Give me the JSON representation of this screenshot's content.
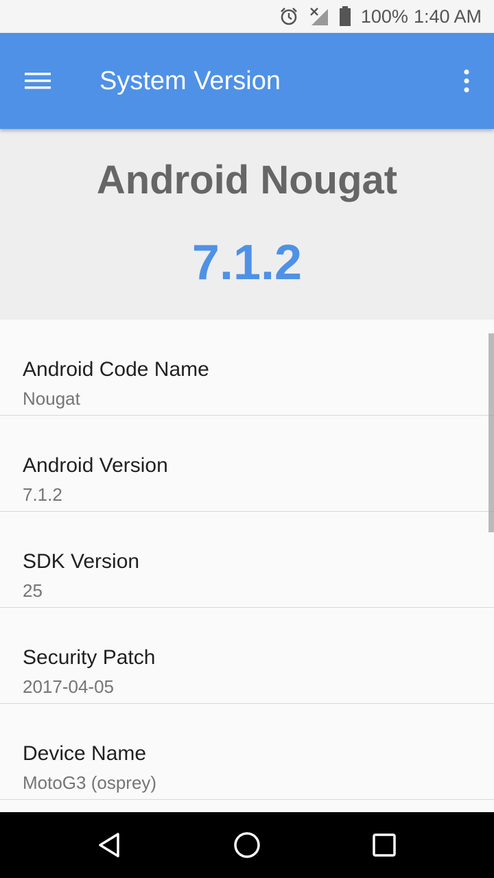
{
  "status_bar": {
    "icons": [
      "alarm-icon",
      "signal-off-icon",
      "battery-icon"
    ],
    "battery_text": "100%",
    "time": "1:40 AM"
  },
  "app_bar": {
    "title": "System Version",
    "menu_icon": "hamburger-menu-icon",
    "overflow_icon": "more-vert-icon",
    "color": "#4f91e6"
  },
  "hero": {
    "name": "Android Nougat",
    "version": "7.1.2",
    "name_color": "#666666",
    "version_color": "#4f91e6"
  },
  "items": [
    {
      "title": "Android Code Name",
      "value": "Nougat"
    },
    {
      "title": "Android Version",
      "value": "7.1.2"
    },
    {
      "title": "SDK Version",
      "value": "25"
    },
    {
      "title": "Security Patch",
      "value": "2017-04-05"
    },
    {
      "title": "Device Name",
      "value": "MotoG3 (osprey)"
    }
  ],
  "nav_bar": {
    "buttons": [
      "back-icon",
      "home-icon",
      "recents-icon"
    ]
  }
}
